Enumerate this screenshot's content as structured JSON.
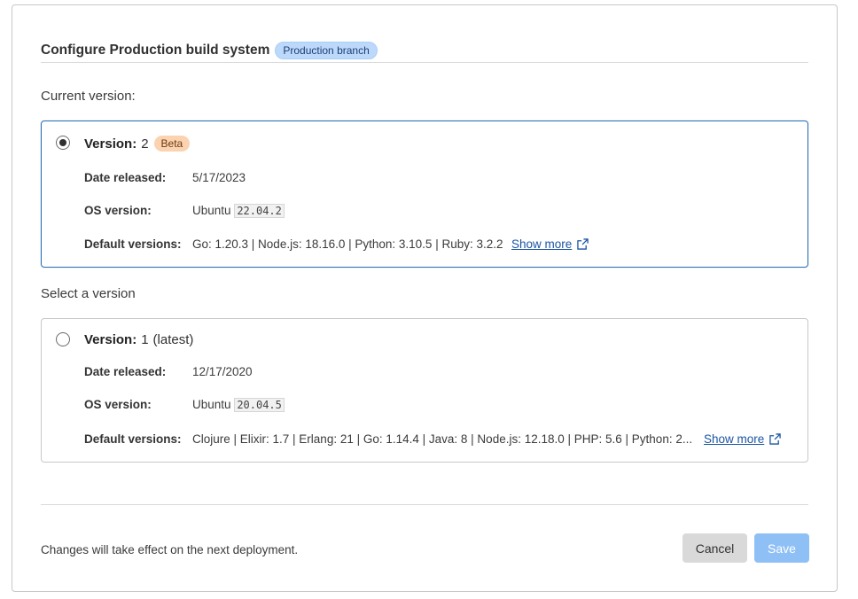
{
  "header": {
    "title": "Configure Production build system",
    "badge": "Production branch"
  },
  "current": {
    "section_label": "Current version:",
    "version_label": "Version:",
    "version_num": "2",
    "badge": "Beta",
    "date_label": "Date released:",
    "date": "5/17/2023",
    "os_label": "OS version:",
    "os_name": "Ubuntu",
    "os_version": "22.04.2",
    "defaults_label": "Default versions:",
    "defaults": "Go: 1.20.3 | Node.js: 18.16.0 | Python: 3.10.5 | Ruby: 3.2.2",
    "show_more": "Show more",
    "selected": true
  },
  "select": {
    "section_label": "Select a version",
    "version_label": "Version:",
    "version_num": "1",
    "version_suffix": "(latest)",
    "date_label": "Date released:",
    "date": "12/17/2020",
    "os_label": "OS version:",
    "os_name": "Ubuntu",
    "os_version": "20.04.5",
    "defaults_label": "Default versions:",
    "defaults": "Clojure | Elixir: 1.7 | Erlang: 21 | Go: 1.14.4 | Java: 8 | Node.js: 12.18.0 | PHP: 5.6 | Python: 2....",
    "show_more": "Show more",
    "selected": false
  },
  "footer": {
    "note": "Changes will take effect on the next deployment.",
    "cancel_label": "Cancel",
    "save_label": "Save"
  },
  "colors": {
    "accent": "#2a6fb3",
    "link": "#1a55a3",
    "save_disabled": "#8fc0f5",
    "beta_badge": "#fcd3b0",
    "branch_badge": "#bcd9fb"
  },
  "icons": {
    "radio_checked": "radio-selected-icon",
    "radio_unchecked": "radio-unselected-icon",
    "external_link": "external-link-icon"
  }
}
